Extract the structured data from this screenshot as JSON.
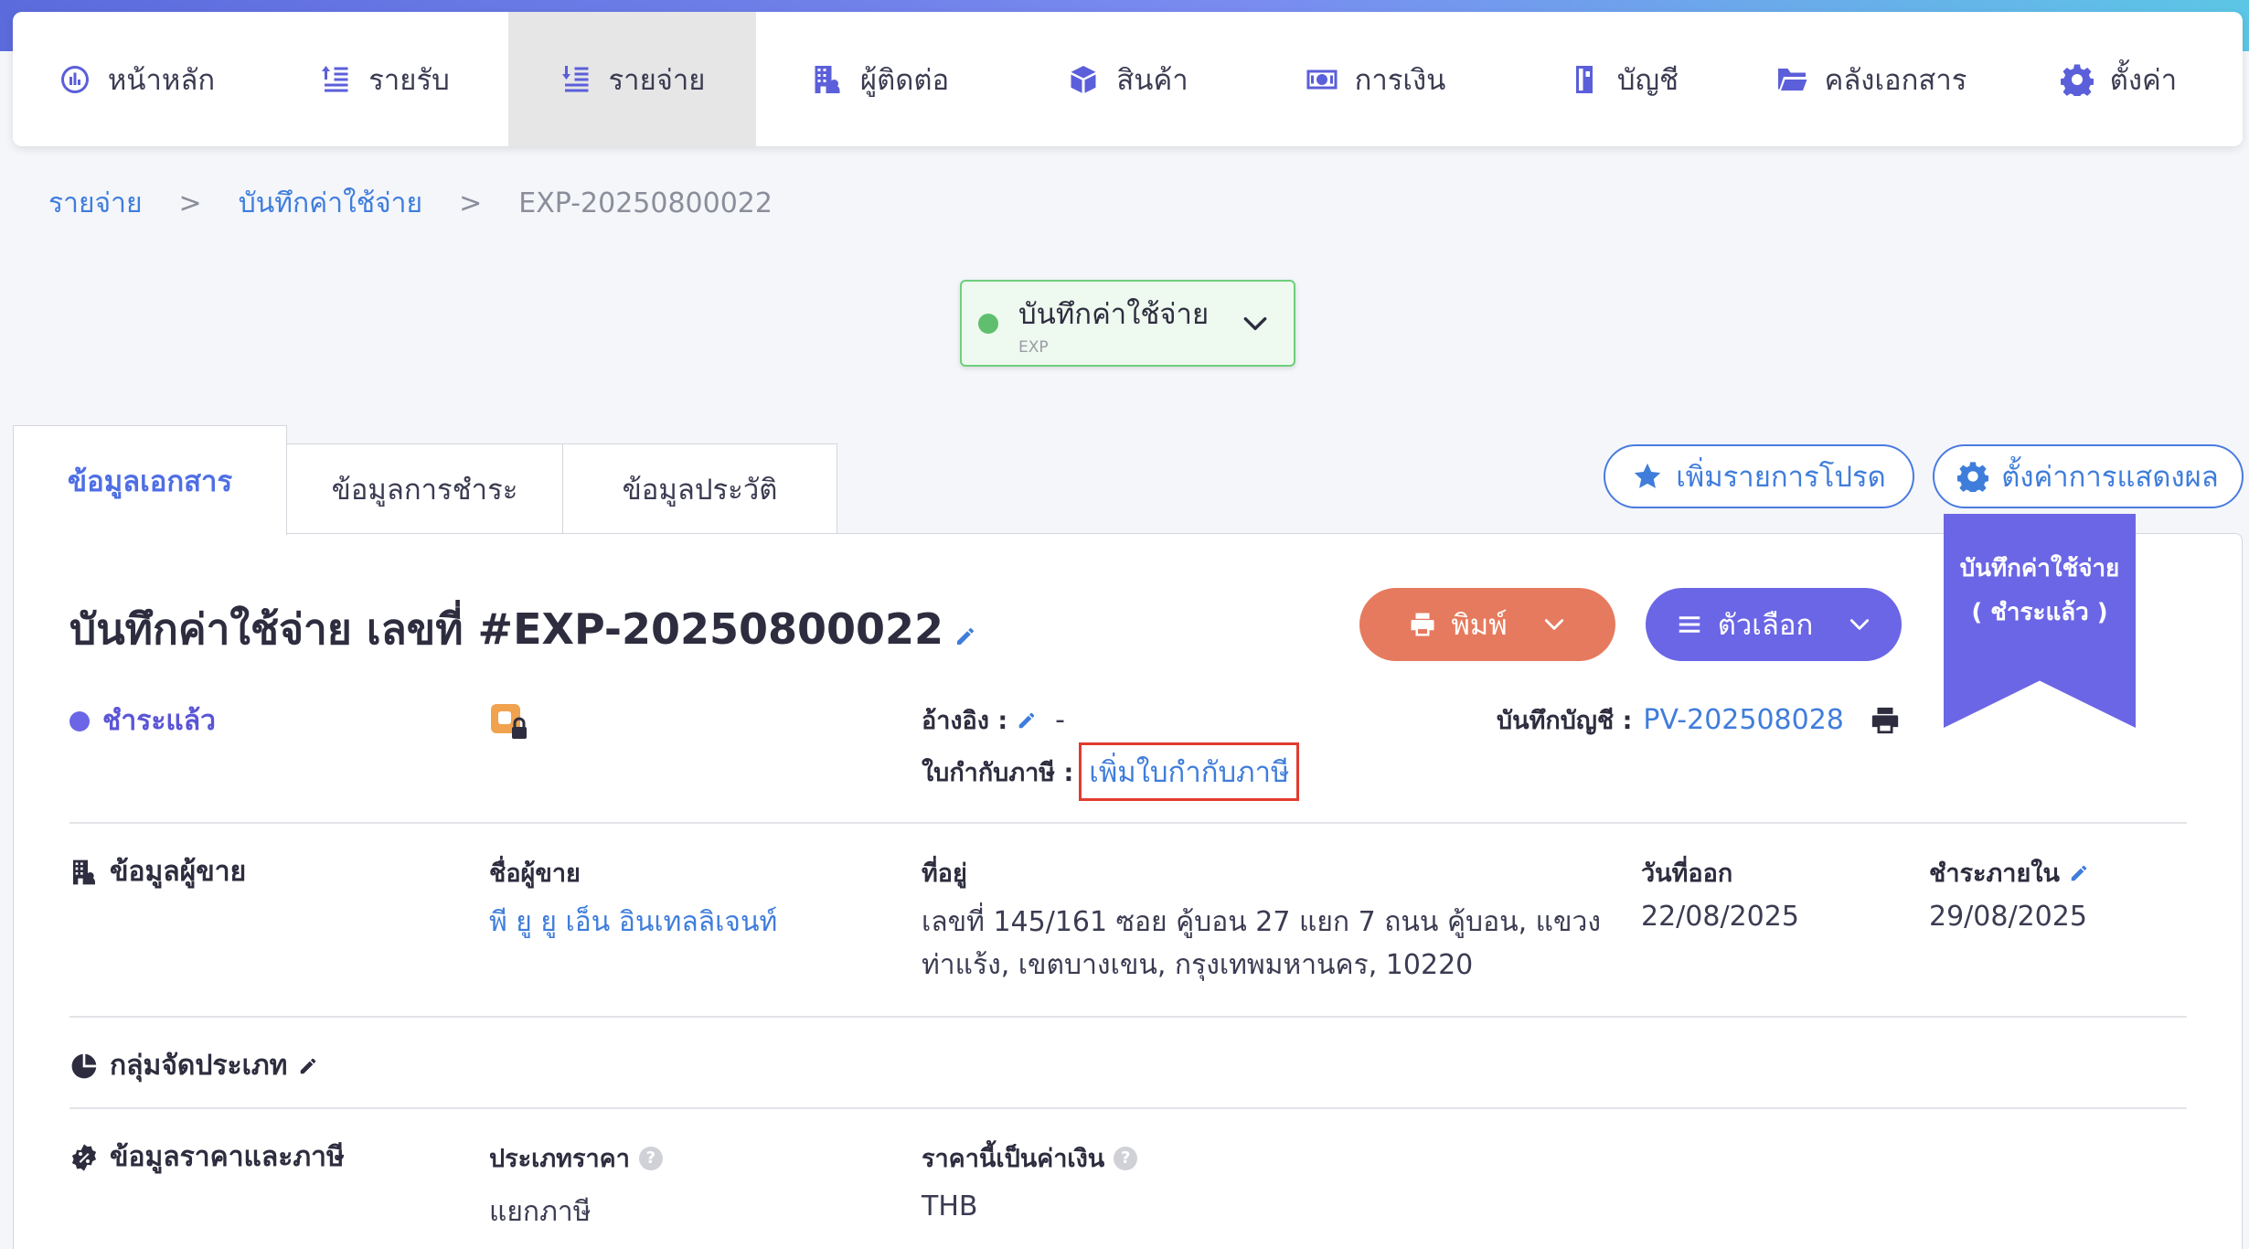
{
  "nav": {
    "items": [
      {
        "label": "หน้าหลัก",
        "icon": "dashboard-icon"
      },
      {
        "label": "รายรับ",
        "icon": "income-icon"
      },
      {
        "label": "รายจ่าย",
        "icon": "expense-icon",
        "active": true
      },
      {
        "label": "ผู้ติดต่อ",
        "icon": "contacts-icon"
      },
      {
        "label": "สินค้า",
        "icon": "box-icon"
      },
      {
        "label": "การเงิน",
        "icon": "money-icon"
      },
      {
        "label": "บัญชี",
        "icon": "ledger-icon"
      },
      {
        "label": "คลังเอกสาร",
        "icon": "folder-icon"
      },
      {
        "label": "ตั้งค่า",
        "icon": "gear-icon"
      }
    ]
  },
  "breadcrumb": {
    "items": [
      "รายจ่าย",
      "บันทึกค่าใช้จ่าย"
    ],
    "separator": ">",
    "current": "EXP-20250800022"
  },
  "doc_type": {
    "label": "บันทึกค่าใช้จ่าย",
    "code": "EXP"
  },
  "tabs": [
    "ข้อมูลเอกสาร",
    "ข้อมูลการชำระ",
    "ข้อมูลประวัติ"
  ],
  "actions": {
    "favorite_label": "เพิ่มรายการโปรด",
    "display_settings_label": "ตั้งค่าการแสดงผล",
    "print_label": "พิมพ์",
    "options_label": "ตัวเลือก"
  },
  "ribbon": {
    "line1": "บันทึกค่าใช้จ่าย",
    "line2": "( ชำระแล้ว )"
  },
  "document": {
    "title": "บันทึกค่าใช้จ่าย เลขที่ #EXP-20250800022",
    "status": "ชำระแล้ว",
    "reference_label": "อ้างอิง :",
    "reference_value": "-",
    "tax_invoice_label": "ใบกำกับภาษี :",
    "tax_invoice_link": "เพิ่มใบกำกับภาษี",
    "account_label": "บันทึกบัญชี :",
    "account_value": "PV-202508028"
  },
  "vendor": {
    "section_title": "ข้อมูลผู้ขาย",
    "name_label": "ชื่อผู้ขาย",
    "name": "พี ยู ยู เอ็น อินเทลลิเจนท์",
    "address_label": "ที่อยู่",
    "address": "เลขที่ 145/161 ซอย คู้บอน 27 แยก 7 ถนน คู้บอน, แขวงท่าแร้ง, เขตบางเขน, กรุงเทพมหานคร, 10220",
    "issue_date_label": "วันที่ออก",
    "issue_date": "22/08/2025",
    "due_label": "ชำระภายใน",
    "due_date": "29/08/2025"
  },
  "category": {
    "section_title": "กลุ่มจัดประเภท"
  },
  "pricing": {
    "section_title": "ข้อมูลราคาและภาษี",
    "price_type_label": "ประเภทราคา",
    "price_type": "แยกภาษี",
    "currency_label": "ราคานี้เป็นค่าเงิน",
    "currency": "THB",
    "help_glyph": "?"
  },
  "colors": {
    "accent": "#6b66e6",
    "link": "#3f7ddb",
    "print_button": "#e67a5e",
    "status_green": "#5fbf6e",
    "highlight_border": "#e23b2e"
  }
}
